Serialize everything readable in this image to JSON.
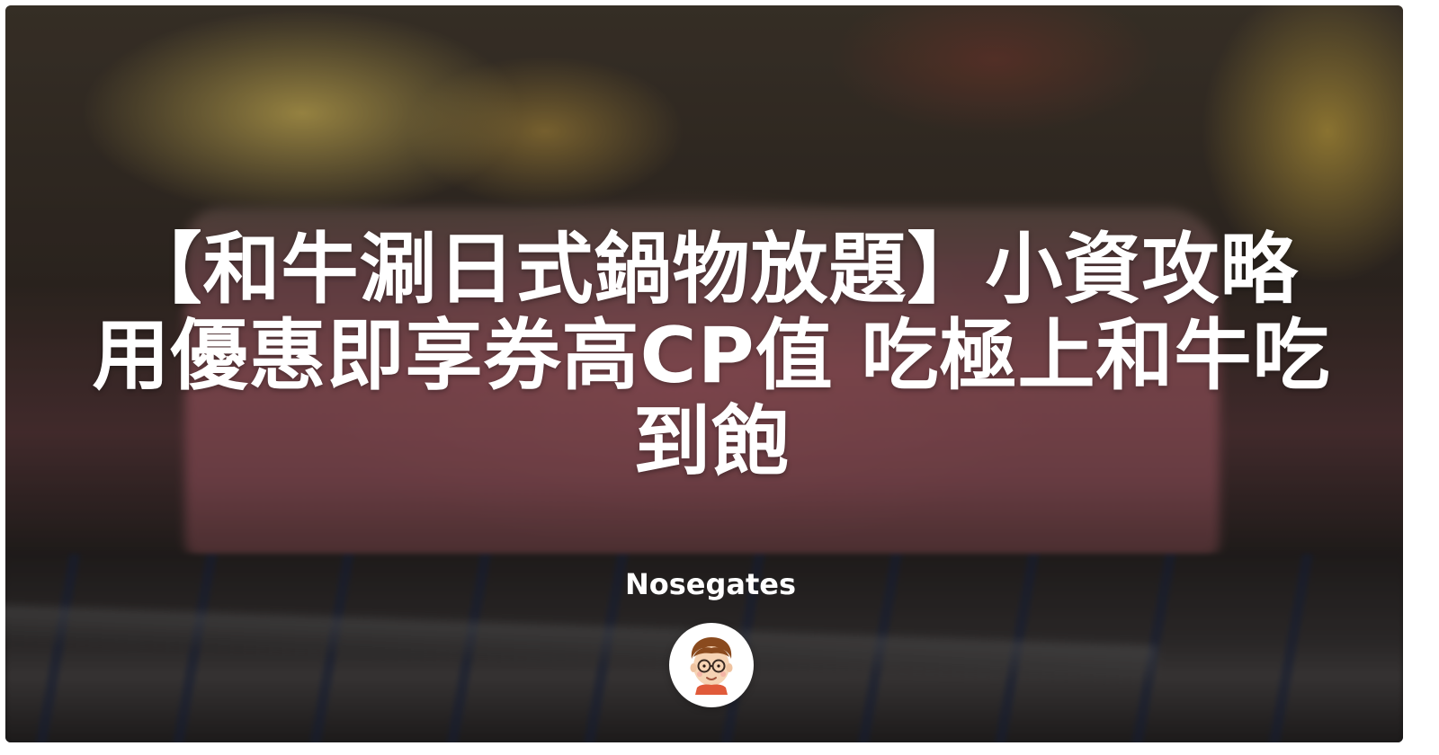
{
  "title": "【和牛涮日式鍋物放題】小資攻略 用優惠即享券高CP值 吃極上和牛吃到飽",
  "author": {
    "name": "Nosegates",
    "avatar_icon": "cartoon-face-with-glasses-icon"
  },
  "background": {
    "subject": "wagyu-on-grill-photo",
    "overlay_color": "#000000"
  }
}
